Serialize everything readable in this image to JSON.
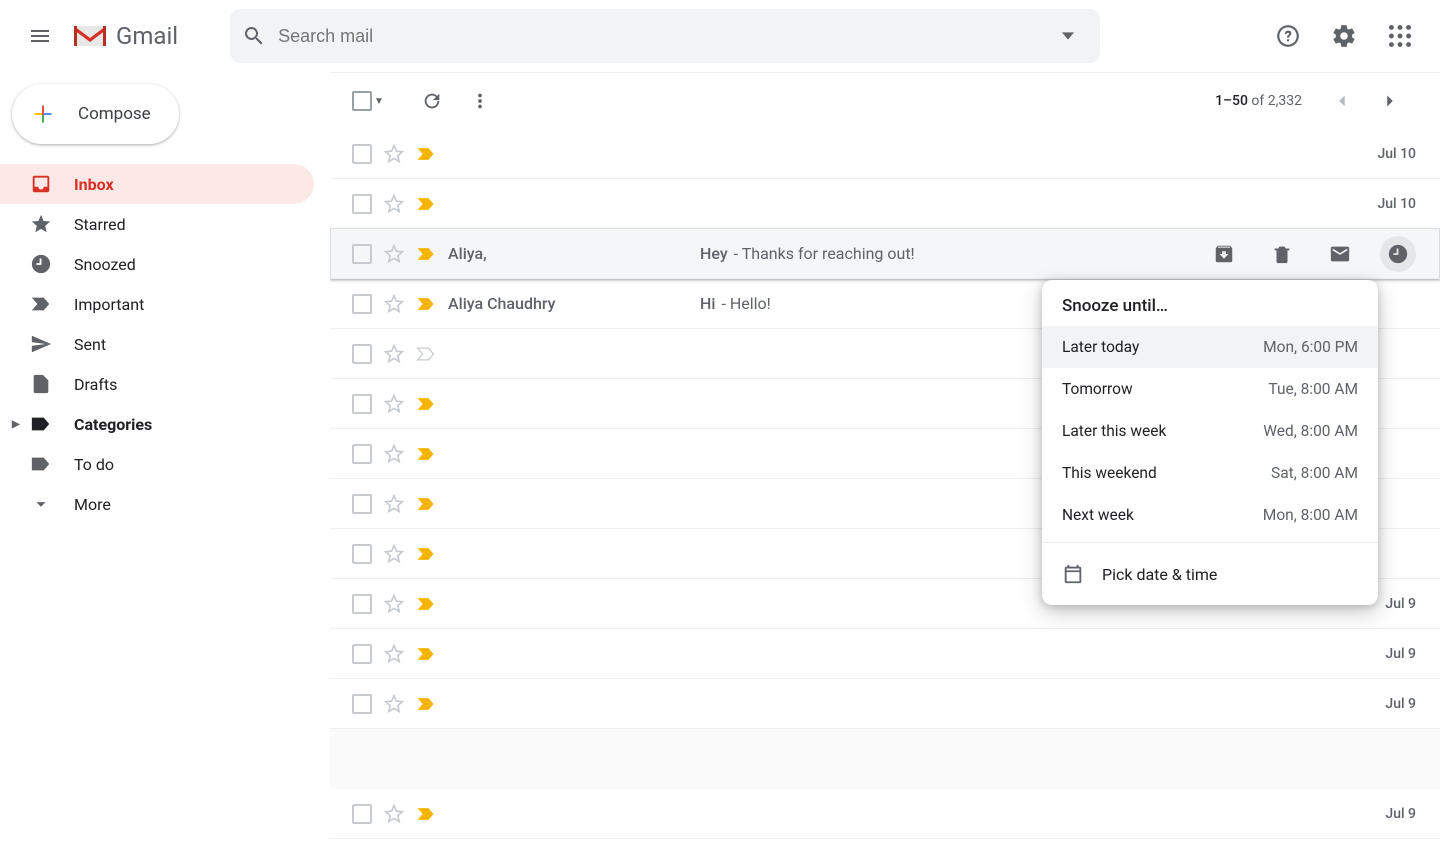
{
  "app": {
    "name": "Gmail"
  },
  "search": {
    "placeholder": "Search mail"
  },
  "compose": {
    "label": "Compose"
  },
  "sidebar": {
    "items": [
      {
        "label": "Inbox"
      },
      {
        "label": "Starred"
      },
      {
        "label": "Snoozed"
      },
      {
        "label": "Important"
      },
      {
        "label": "Sent"
      },
      {
        "label": "Drafts"
      },
      {
        "label": "Categories"
      },
      {
        "label": "To do"
      },
      {
        "label": "More"
      }
    ]
  },
  "pagination": {
    "range": "1–50",
    "of_word": "of",
    "total": "2,332"
  },
  "emails": [
    {
      "sender": "",
      "subject": "",
      "preview": "",
      "date": "Jul 10",
      "important": true
    },
    {
      "sender": "",
      "subject": "",
      "preview": "",
      "date": "Jul 10",
      "important": true
    },
    {
      "sender": "Aliya,",
      "subject": "Hey",
      "preview": "- Thanks for reaching out!",
      "date": "",
      "important": true,
      "hovered": true
    },
    {
      "sender": "Aliya Chaudhry",
      "subject": "Hi",
      "preview": "- Hello!",
      "date": "",
      "important": true
    },
    {
      "sender": "",
      "subject": "",
      "preview": "",
      "date": "",
      "important": false
    },
    {
      "sender": "",
      "subject": "",
      "preview": "",
      "date": "",
      "important": true
    },
    {
      "sender": "",
      "subject": "",
      "preview": "",
      "date": "",
      "important": true
    },
    {
      "sender": "",
      "subject": "",
      "preview": "",
      "date": "",
      "important": true
    },
    {
      "sender": "",
      "subject": "",
      "preview": "",
      "date": "",
      "important": true
    },
    {
      "sender": "",
      "subject": "",
      "preview": "",
      "date": "Jul 9",
      "important": true
    },
    {
      "sender": "",
      "subject": "",
      "preview": "",
      "date": "Jul 9",
      "important": true
    },
    {
      "sender": "",
      "subject": "",
      "preview": "",
      "date": "Jul 9",
      "important": true
    },
    {
      "sender": "",
      "subject": "",
      "preview": "",
      "date": "Jul 9",
      "important": true,
      "blank_above": true
    }
  ],
  "snooze": {
    "header": "Snooze until…",
    "options": [
      {
        "label": "Later today",
        "time": "Mon, 6:00 PM",
        "highlighted": true
      },
      {
        "label": "Tomorrow",
        "time": "Tue, 8:00 AM"
      },
      {
        "label": "Later this week",
        "time": "Wed, 8:00 AM"
      },
      {
        "label": "This weekend",
        "time": "Sat, 8:00 AM"
      },
      {
        "label": "Next week",
        "time": "Mon, 8:00 AM"
      }
    ],
    "pick_label": "Pick date & time"
  }
}
